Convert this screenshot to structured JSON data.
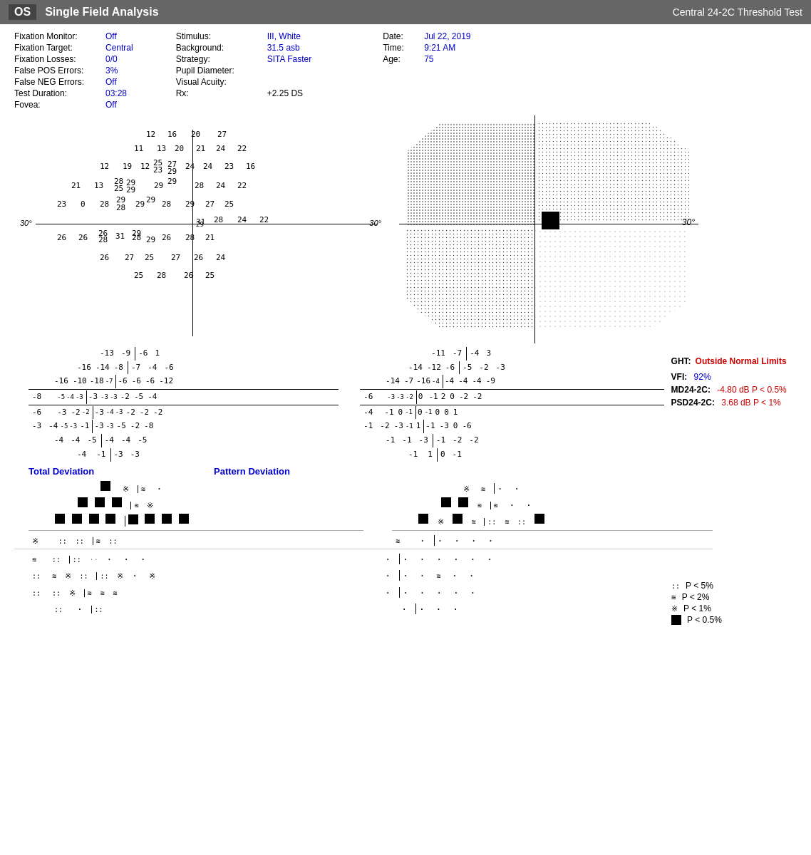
{
  "header": {
    "eye": "OS",
    "title": "Single Field Analysis",
    "test": "Central 24-2C Threshold Test"
  },
  "patient_info": {
    "fixation_monitor": {
      "label": "Fixation Monitor:",
      "value": "Off"
    },
    "fixation_target": {
      "label": "Fixation Target:",
      "value": "Central"
    },
    "fixation_losses": {
      "label": "Fixation Losses:",
      "value": "0/0"
    },
    "false_pos": {
      "label": "False POS Errors:",
      "value": "3%"
    },
    "false_neg": {
      "label": "False NEG Errors:",
      "value": "Off"
    },
    "test_duration": {
      "label": "Test Duration:",
      "value": "03:28"
    },
    "fovea": {
      "label": "Fovea:",
      "value": "Off"
    }
  },
  "stimulus_info": {
    "stimulus": {
      "label": "Stimulus:",
      "value": "III, White"
    },
    "background": {
      "label": "Background:",
      "value": "31.5 asb"
    },
    "strategy": {
      "label": "Strategy:",
      "value": "SITA Faster"
    },
    "pupil": {
      "label": "Pupil Diameter:",
      "value": ""
    },
    "acuity": {
      "label": "Visual Acuity:",
      "value": ""
    },
    "rx": {
      "label": "Rx:",
      "value": "+2.25 DS"
    }
  },
  "date_info": {
    "date": {
      "label": "Date:",
      "value": "Jul 22, 2019"
    },
    "time": {
      "label": "Time:",
      "value": "9:21 AM"
    },
    "age": {
      "label": "Age:",
      "value": "75"
    }
  },
  "stats": {
    "ght_label": "GHT:",
    "ght_value": "Outside Normal Limits",
    "vfi_label": "VFI:",
    "vfi_value": "92%",
    "md_label": "MD24-2C:",
    "md_value": "-4.80 dB P < 0.5%",
    "psd_label": "PSD24-2C:",
    "psd_value": "3.68 dB P < 1%"
  },
  "legend": {
    "items": [
      {
        "symbol": "::",
        "text": "P < 5%"
      },
      {
        "symbol": "≋",
        "text": "P < 2%"
      },
      {
        "symbol": "※",
        "text": "P < 1%"
      },
      {
        "symbol": "■",
        "text": "P < 0.5%"
      }
    ]
  },
  "sections": {
    "total_deviation": "Total Deviation",
    "pattern_deviation": "Pattern Deviation"
  }
}
